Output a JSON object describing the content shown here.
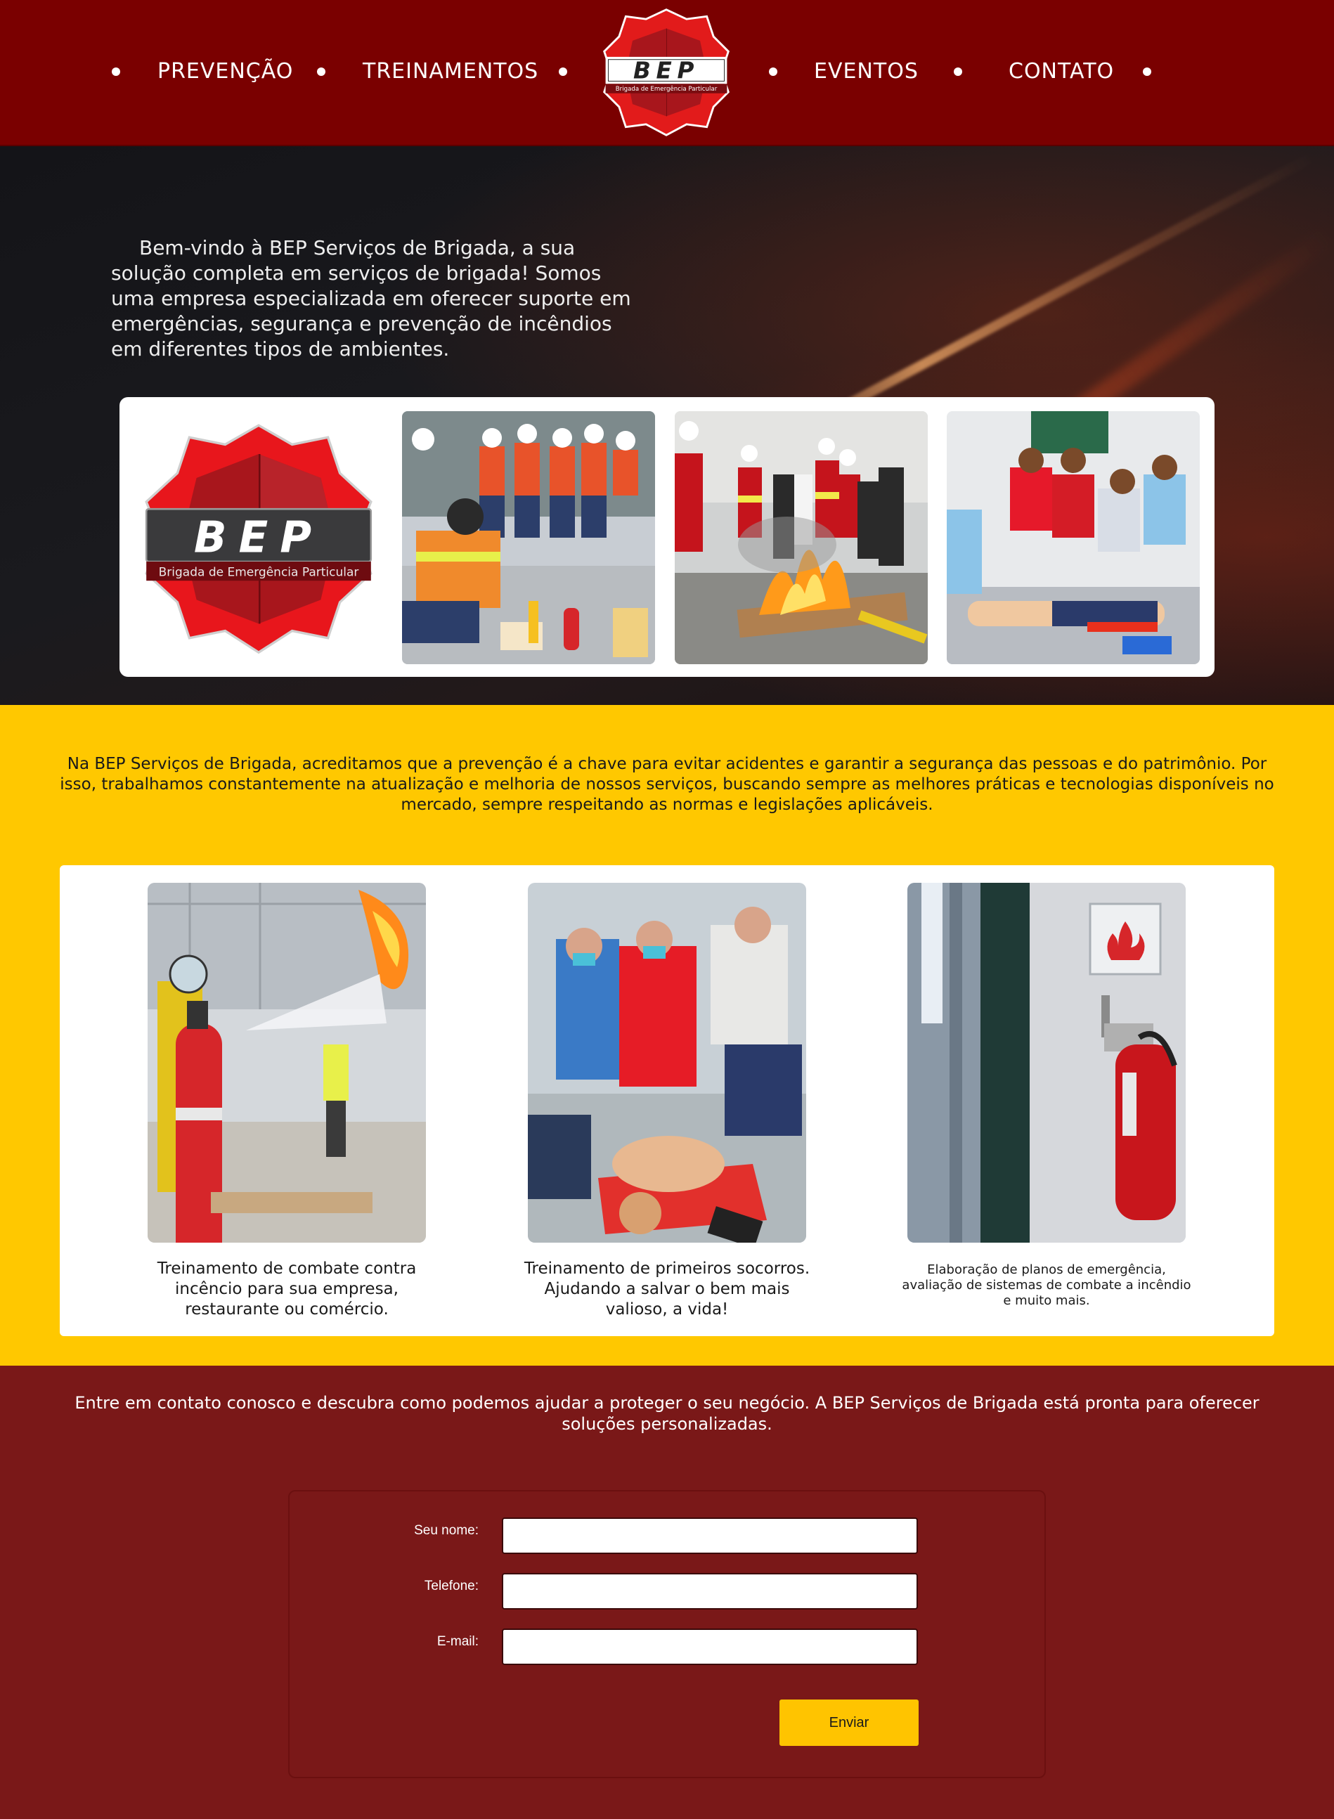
{
  "header": {
    "nav_left": [
      "PREVENÇÃO",
      "TREINAMENTOS"
    ],
    "nav_right": [
      "EVENTOS",
      "CONTATO"
    ],
    "logo_text": "BEP",
    "logo_subtext": "Brigada de Emergência Particular"
  },
  "hero": {
    "intro": "Bem-vindo à BEP Serviços de Brigada, a sua solução completa em serviços de brigada! Somos uma empresa especializada em oferecer suporte em emergências, segurança e prevenção de incêndios em diferentes tipos de ambientes.",
    "gallery_logo_text": "BEP",
    "gallery_logo_subtext": "Brigada de Emergência Particular"
  },
  "mission": {
    "text": "Na BEP Serviços de Brigada, acreditamos que a prevenção é a chave para evitar acidentes e garantir a segurança das pessoas e do patrimônio. Por isso, trabalhamos constantemente na atualização e melhoria de nossos serviços, buscando sempre as melhores práticas e tecnologias disponíveis no mercado, sempre respeitando as normas e legislações aplicáveis."
  },
  "services": [
    {
      "caption": "Treinamento de combate contra incêncio para sua empresa, restaurante ou comércio."
    },
    {
      "caption": "Treinamento de primeiros socorros. Ajudando a salvar o bem mais valioso, a vida!"
    },
    {
      "caption": "Elaboração de planos de emergência, avaliação de sistemas de combate a incêndio e muito mais."
    }
  ],
  "contact": {
    "text": "Entre em contato conosco e descubra como podemos ajudar a proteger o seu negócio. A BEP Serviços de Brigada está pronta para oferecer soluções personalizadas.",
    "name_label": "Seu nome:",
    "phone_label": "Telefone:",
    "email_label": "E-mail:",
    "name_value": "",
    "phone_value": "",
    "email_value": "",
    "submit_label": "Enviar"
  },
  "colors": {
    "header_bg": "#7a0000",
    "accent_yellow": "#ffc800",
    "contact_bg": "#7a1818",
    "logo_red": "#e21b1b"
  }
}
